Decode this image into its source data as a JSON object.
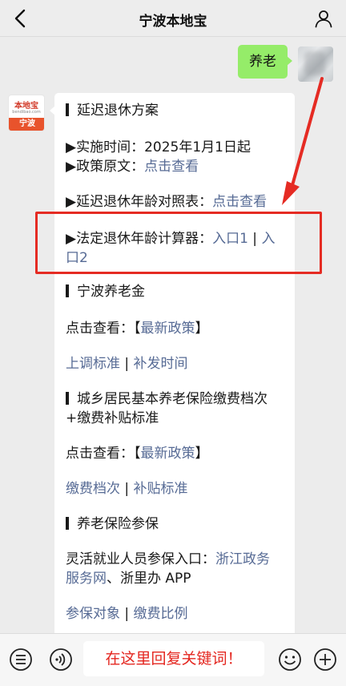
{
  "header": {
    "title": "宁波本地宝"
  },
  "avatar_bot": {
    "logo": "本地宝",
    "logo_sub": "bendibao.com",
    "badge": "宁波"
  },
  "user_message": "养老",
  "reply": {
    "s1_title": "延迟退休方案",
    "s1_time_label": "▶实施时间：",
    "s1_time_value": "2025年1月1日起",
    "s1_policy_label": "▶政策原文：",
    "s1_policy_link": "点击查看",
    "s1_table_label": "▶延迟退休年龄对照表：",
    "s1_table_link": "点击查看",
    "s1_calc_label": "▶法定退休年龄计算器：",
    "s1_calc_link1": "入口1",
    "s1_sep": " | ",
    "s1_calc_link2_a": "入",
    "s1_calc_link2_b": "口2",
    "s2_title": "宁波养老金",
    "s2_view_label": "点击查看：",
    "s2_bracket_open": "【",
    "s2_latest_link": "最新政策",
    "s2_bracket_close": "】",
    "s2_link_a": "上调标准",
    "s2_sep": " | ",
    "s2_link_b": "补发时间",
    "s3_title_line1": "城乡居民基本养老保险缴费档次",
    "s3_title_line2": "+缴费补贴标准",
    "s3_view_label": "点击查看：",
    "s3_bracket_open": "【",
    "s3_latest_link": "最新政策",
    "s3_bracket_close": "】",
    "s3_link_a": "缴费档次",
    "s3_sep": " | ",
    "s3_link_b": "补贴标准",
    "s4_title": "养老保险参保",
    "s4_entry_label": "灵活就业人员参保入口：",
    "s4_link_a_line1": "浙江政务",
    "s4_link_a_line2": "服务网",
    "s4_mid": "、浙里办 APP",
    "s4_link_b": "参保对象",
    "s4_sep": " | ",
    "s4_link_c": "缴费比例"
  },
  "bottom_bar": {
    "input_text": "在这里回复关键词！"
  },
  "colors": {
    "link": "#576b95",
    "annotation_red": "#e52b23",
    "my_bubble": "#95ec69"
  }
}
